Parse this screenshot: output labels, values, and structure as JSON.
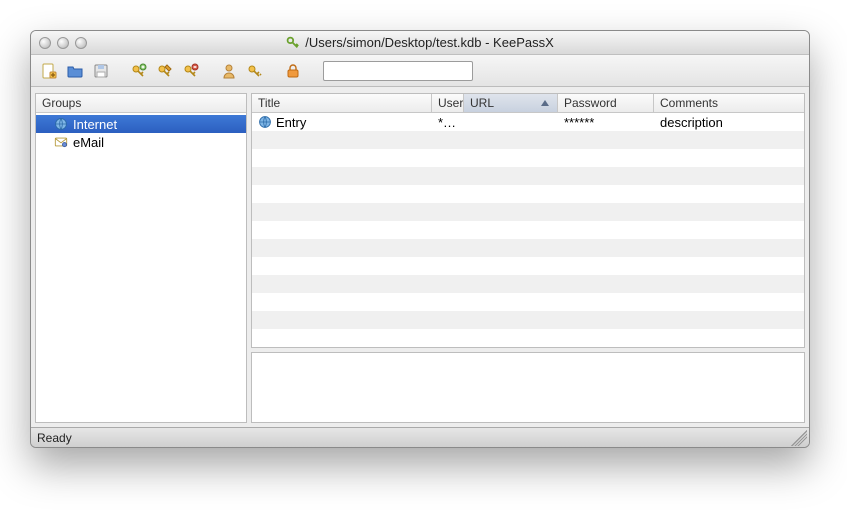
{
  "window": {
    "title": "/Users/simon/Desktop/test.kdb - KeePassX"
  },
  "toolbar": {
    "search_value": ""
  },
  "groups": {
    "header": "Groups",
    "items": [
      {
        "label": "Internet",
        "selected": true,
        "icon": "globe"
      },
      {
        "label": "eMail",
        "selected": false,
        "icon": "mail"
      }
    ]
  },
  "entries": {
    "columns": {
      "title": "Title",
      "username": "User",
      "url": "URL",
      "password": "Password",
      "comments": "Comments",
      "sorted_column": "url",
      "sort_direction": "asc"
    },
    "rows": [
      {
        "title": "Entry",
        "username": "*…",
        "url": "",
        "password": "******",
        "comments": "description"
      }
    ]
  },
  "status": {
    "text": "Ready"
  }
}
